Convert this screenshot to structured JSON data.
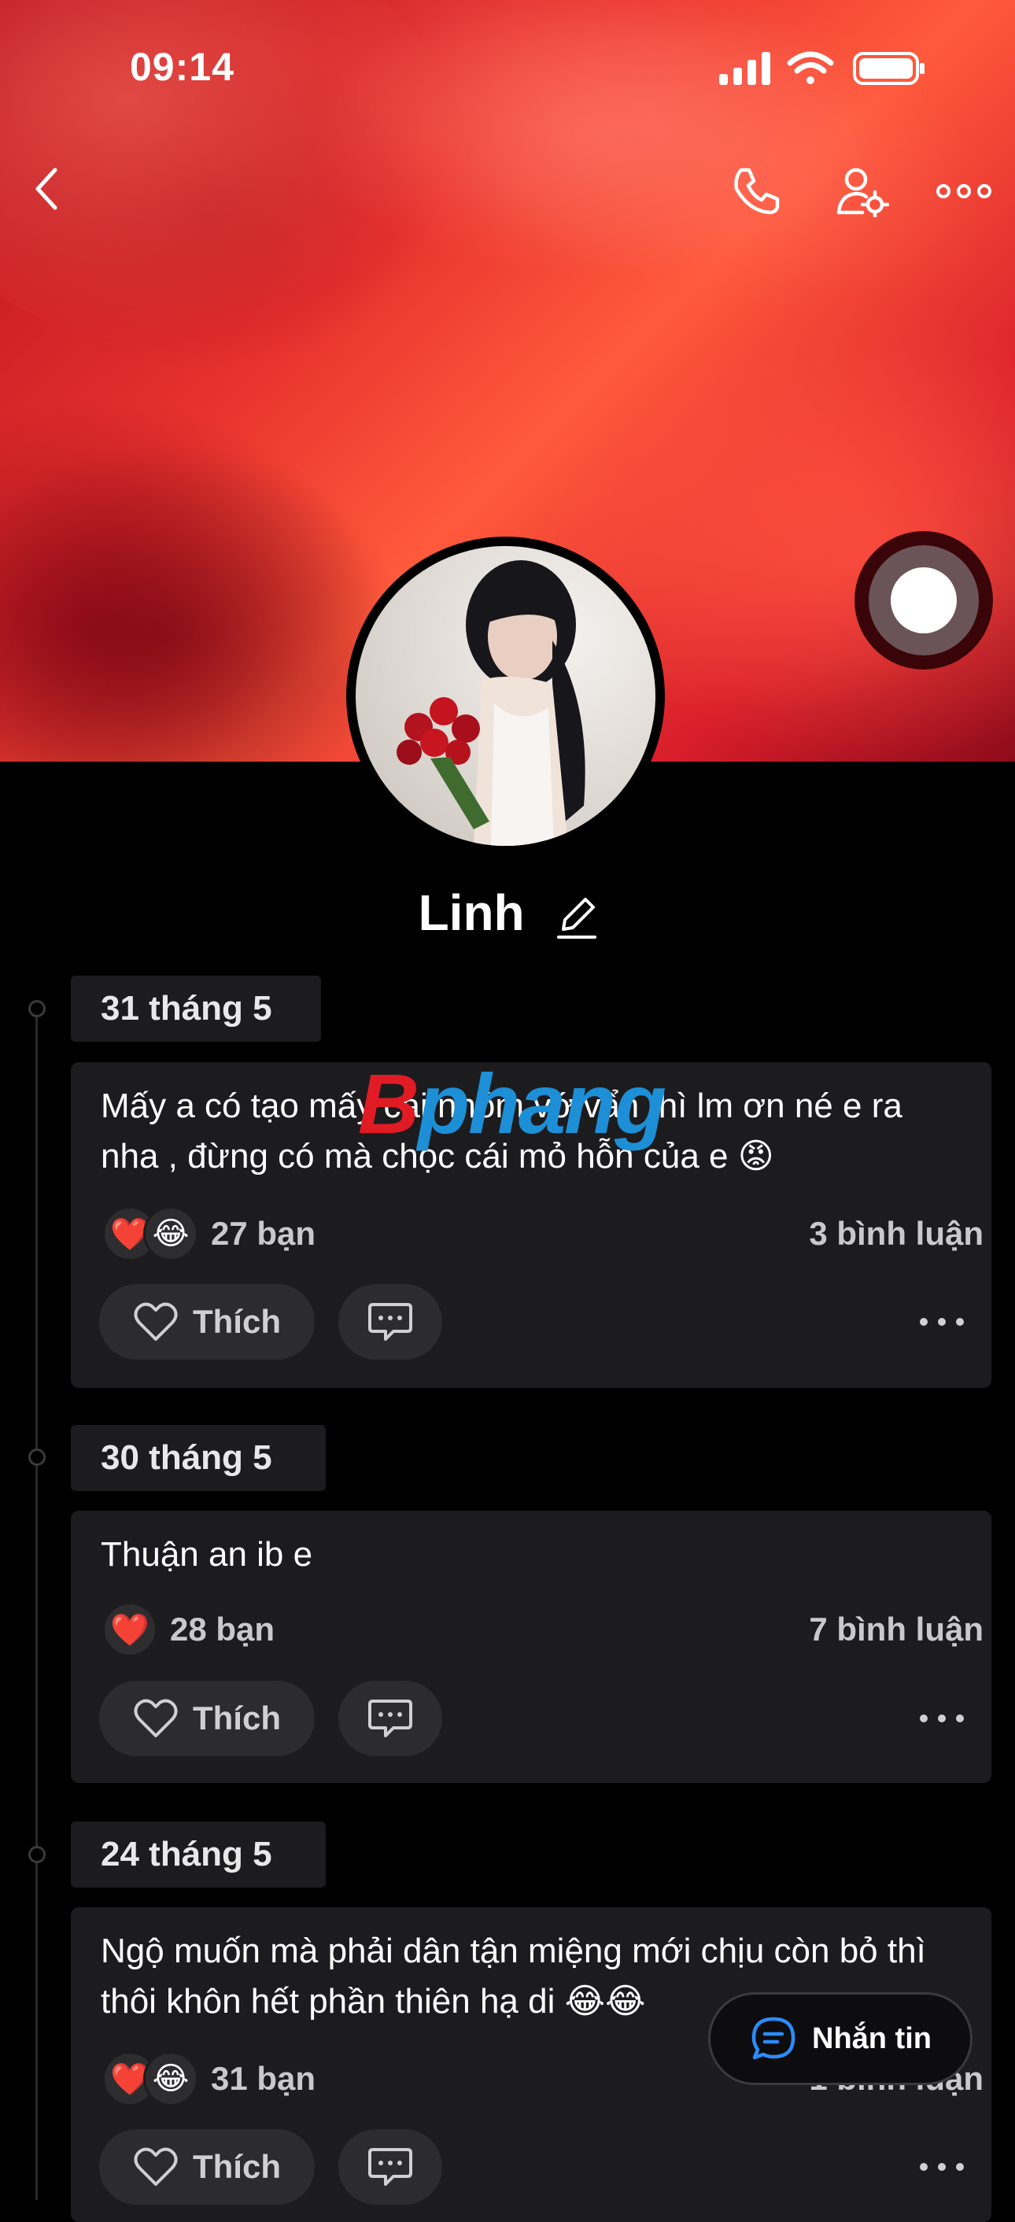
{
  "status_bar": {
    "time": "09:14"
  },
  "profile": {
    "name": "Linh"
  },
  "watermark": {
    "prefix": "B",
    "rest": "phang"
  },
  "icons": {
    "back": "chevron-left-icon",
    "call": "phone-icon",
    "settings": "user-settings-icon",
    "more": "more-icon",
    "edit": "pencil-icon",
    "like": "heart-outline-icon",
    "comment": "comment-icon",
    "message": "chat-bubble-icon"
  },
  "posts": [
    {
      "date": "31 tháng 5",
      "text": "Mấy a có tạo mấy cái nhóm vớ vẩn thì lm ơn né e ra nha , đừng có mà chọc cái mỏ hỗn của e 😡",
      "reactions": [
        "❤️",
        "😂"
      ],
      "reaction_count": "27 bạn",
      "comments": "3 bình luận",
      "like_label": "Thích"
    },
    {
      "date": "30 tháng 5",
      "text": "Thuận an ib e",
      "reactions": [
        "❤️"
      ],
      "reaction_count": "28 bạn",
      "comments": "7 bình luận",
      "like_label": "Thích"
    },
    {
      "date": "24 tháng 5",
      "text": "Ngộ muốn mà phải dân tận miệng mới chịu còn bỏ thì thôi khôn hết phần thiên hạ di 😂😂",
      "reactions": [
        "❤️",
        "😂"
      ],
      "reaction_count": "31 bạn",
      "comments": "1 bình luận",
      "like_label": "Thích"
    }
  ],
  "message_button": {
    "label": "Nhắn tin"
  }
}
